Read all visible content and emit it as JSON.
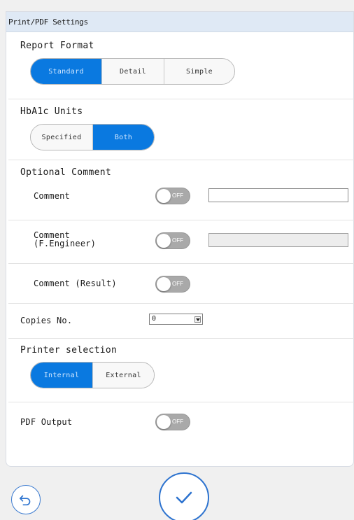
{
  "header": {
    "title": "Print/PDF Settings"
  },
  "report_format": {
    "title": "Report Format",
    "options": [
      "Standard",
      "Detail",
      "Simple"
    ],
    "selected": "Standard"
  },
  "hba1c_units": {
    "title": "HbA1c Units",
    "options": [
      "Specified",
      "Both"
    ],
    "selected": "Both"
  },
  "optional_comment": {
    "title": "Optional Comment",
    "comment_label": "Comment",
    "comment_engineer_label_line1": "Comment",
    "comment_engineer_label_line2": "(F.Engineer)",
    "comment_result_label": "Comment (Result)",
    "comment_value": "",
    "comment_engineer_value": ""
  },
  "toggles": {
    "off_label": "OFF"
  },
  "copies": {
    "label": "Copies No.",
    "value": "0"
  },
  "printer_selection": {
    "title": "Printer selection",
    "options": [
      "Internal",
      "External"
    ],
    "selected": "Internal"
  },
  "pdf_output": {
    "label": "PDF Output"
  },
  "colors": {
    "accent": "#0a79e0",
    "header_bg": "#dfe9f5",
    "toggle_off": "#a9a9a9",
    "footer_button": "#2d73cf"
  },
  "icons": {
    "back": "undo-arrow-icon",
    "confirm": "checkmark-icon"
  }
}
